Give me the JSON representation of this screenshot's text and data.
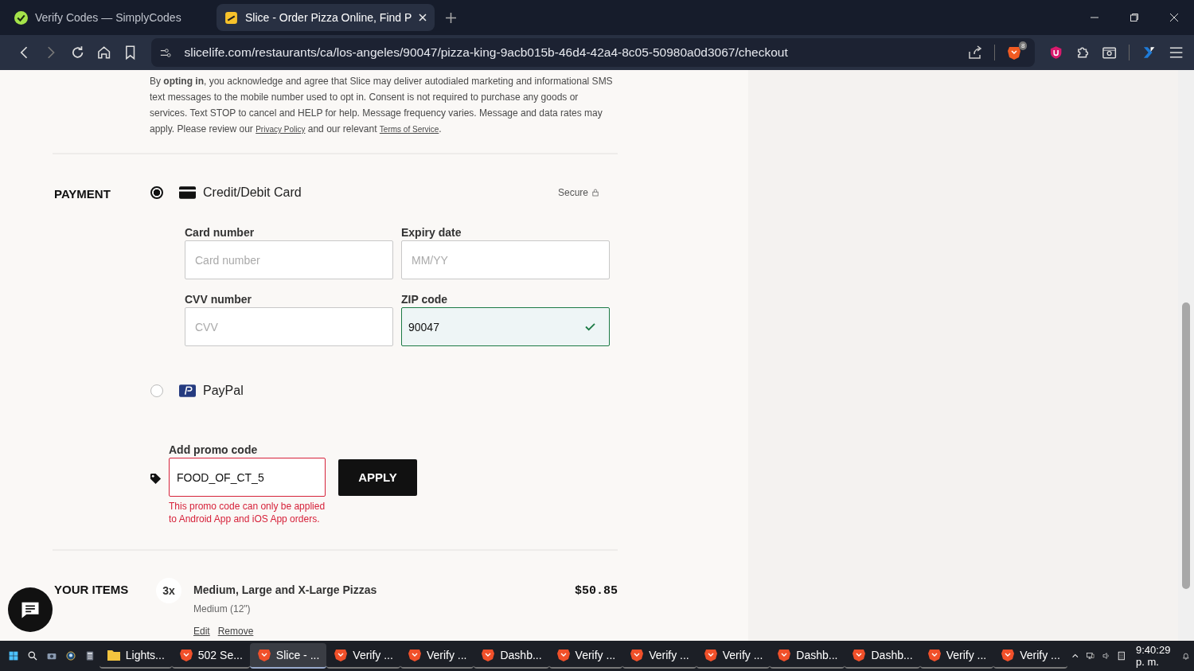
{
  "tabs": [
    {
      "kind": "simplycodes",
      "title": "Verify Codes — SimplyCodes",
      "selected": false
    },
    {
      "kind": "slice",
      "title": "Slice - Order Pizza Online, Find P",
      "selected": true
    }
  ],
  "address": "slicelife.com/restaurants/ca/los-angeles/90047/pizza-king-9acb015b-46d4-42a4-8c05-50980a0d3067/checkout",
  "brave_badge": "8",
  "consent": [
    {
      "kind": "text",
      "text": "By **opting in**, you acknowledge and agree that Slice may deliver autodialed marketing and informational SMS text messages to the mobile number used to opt in. Consent is not required to purchase any goods or services. Text STOP to cancel and HELP for help. Message frequency varies. Message and data rates may apply. Please review our "
    },
    {
      "kind": "link",
      "text": "Privacy Policy"
    },
    {
      "kind": "text",
      "text": " and our relevant "
    },
    {
      "kind": "link",
      "text": "Terms of Service"
    },
    {
      "kind": "text",
      "text": "."
    }
  ],
  "payment": {
    "label": "PAYMENT",
    "secure": "Secure",
    "methods": [
      {
        "kind": "card",
        "label": "Credit/Debit Card",
        "selected": true
      },
      {
        "kind": "paypal",
        "label": "PayPal",
        "selected": false
      }
    ],
    "fields": [
      {
        "label": "Card number",
        "placeholder": "Card number",
        "valid": false
      },
      {
        "label": "Expiry date",
        "placeholder": "MM/YY",
        "valid": false
      },
      {
        "label": "CVV number",
        "placeholder": "CVV",
        "valid": false
      },
      {
        "label": "ZIP code",
        "value": "90047",
        "valid": true
      }
    ]
  },
  "promo": {
    "label": "Add promo code",
    "value": "FOOD_OF_CT_5",
    "error": true,
    "message": "This promo code can only be applied to Android App and iOS App orders.",
    "button": "APPLY"
  },
  "items": {
    "label": "YOUR ITEMS",
    "rows": [
      {
        "qty": "3x",
        "name": "Medium, Large and X-Large Pizzas",
        "detail": "Medium (12\")",
        "price": "$50.85",
        "actions": [
          "Edit",
          "Remove"
        ]
      }
    ]
  },
  "taskbar": {
    "apps": [
      {
        "kind": "folder",
        "label": "Lights...",
        "selected": false
      },
      {
        "kind": "brave",
        "label": "502 Se...",
        "selected": false
      },
      {
        "kind": "brave",
        "label": "Slice - ...",
        "selected": true
      },
      {
        "kind": "brave",
        "label": "Verify ...",
        "selected": false
      },
      {
        "kind": "brave",
        "label": "Verify ...",
        "selected": false
      },
      {
        "kind": "brave",
        "label": "Dashb...",
        "selected": false
      },
      {
        "kind": "brave",
        "label": "Verify ...",
        "selected": false
      },
      {
        "kind": "brave",
        "label": "Verify ...",
        "selected": false
      },
      {
        "kind": "brave",
        "label": "Verify ...",
        "selected": false
      },
      {
        "kind": "brave",
        "label": "Dashb...",
        "selected": false
      },
      {
        "kind": "brave",
        "label": "Dashb...",
        "selected": false
      },
      {
        "kind": "brave",
        "label": "Verify ...",
        "selected": false
      },
      {
        "kind": "brave",
        "label": "Verify ...",
        "selected": false
      }
    ],
    "time": "9:40:29 p. m."
  }
}
